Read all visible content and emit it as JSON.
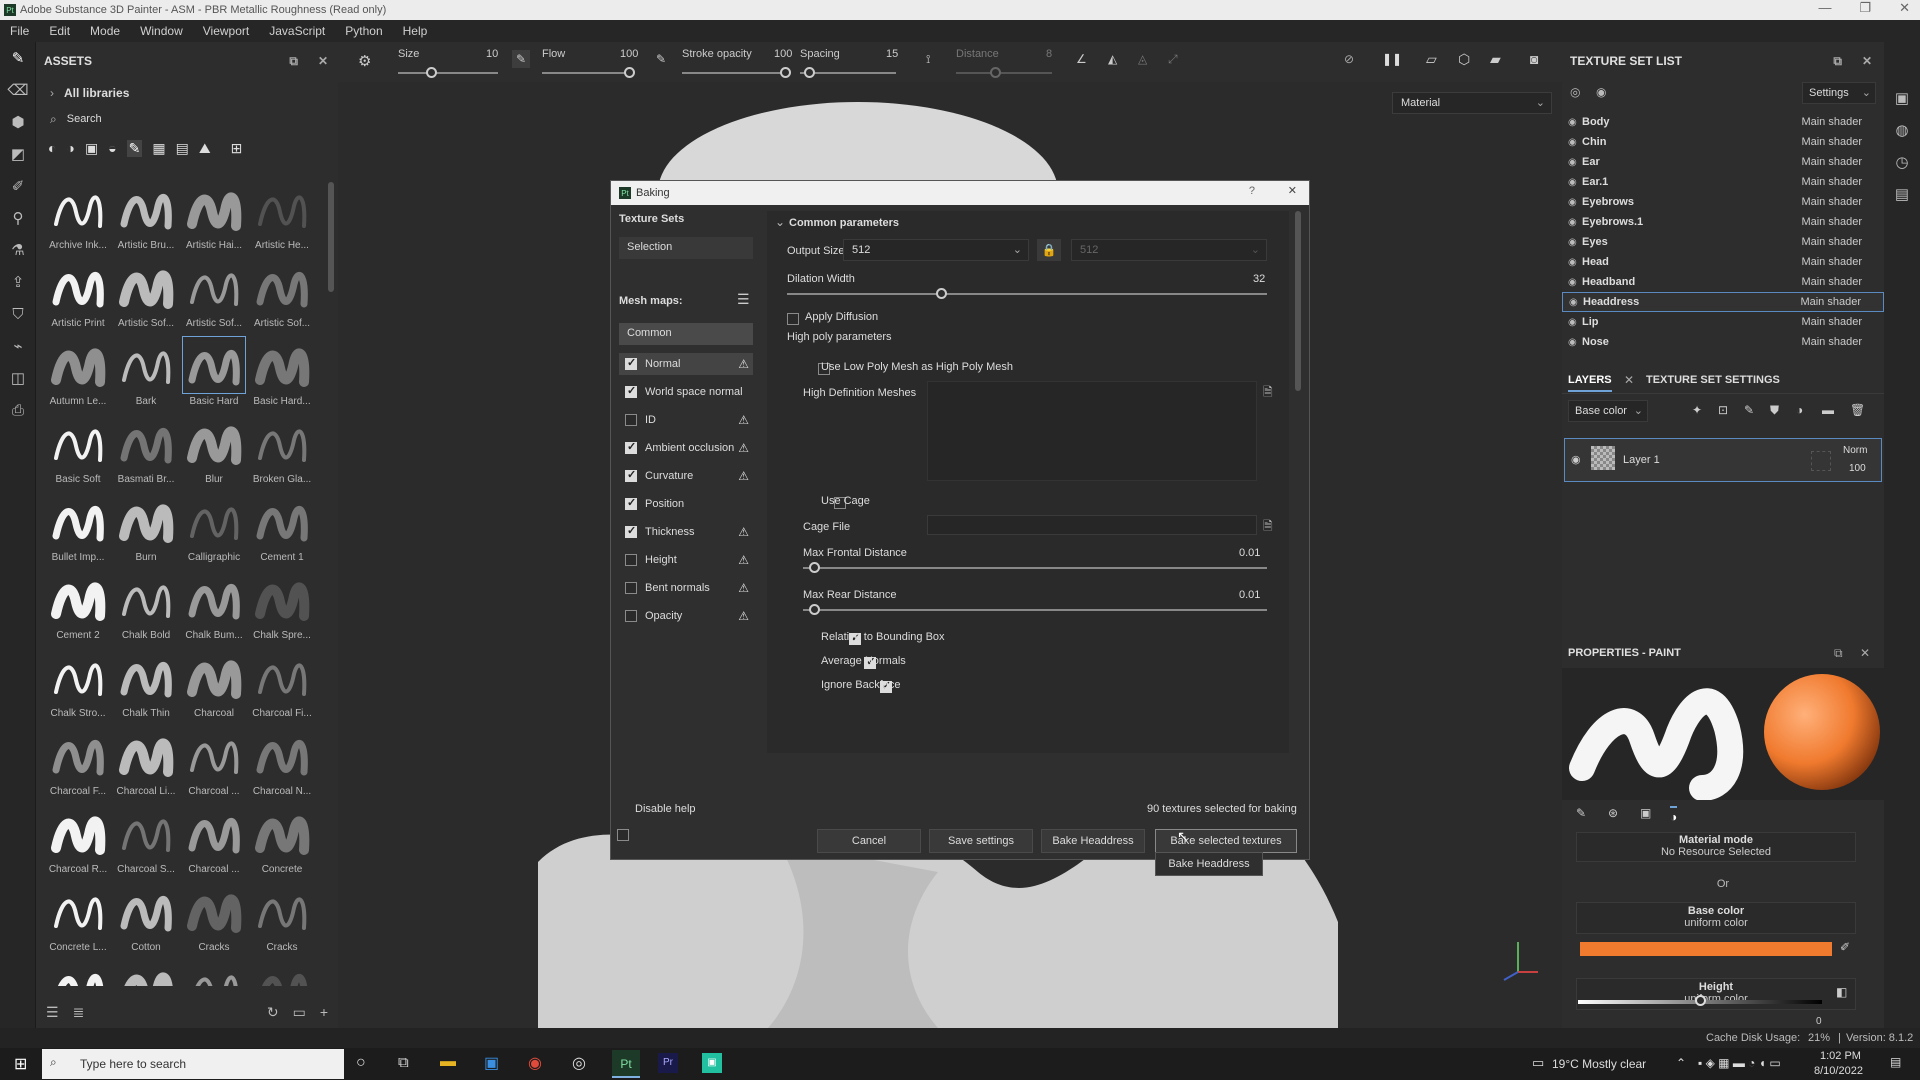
{
  "window": {
    "title": "Adobe Substance 3D Painter - ASM - PBR Metallic Roughness (Read only)",
    "logo": "Pt"
  },
  "menu": [
    "File",
    "Edit",
    "Mode",
    "Window",
    "Viewport",
    "JavaScript",
    "Python",
    "Help"
  ],
  "assets": {
    "title": "ASSETS",
    "libraries": "All libraries",
    "search_placeholder": "Search",
    "brushes": [
      "Archive Ink...",
      "Artistic Bru...",
      "Artistic Hai...",
      "Artistic He...",
      "Artistic Print",
      "Artistic Sof...",
      "Artistic Sof...",
      "Artistic Sof...",
      "Autumn Le...",
      "Bark",
      "Basic Hard",
      "Basic Hard...",
      "Basic Soft",
      "Basmati Br...",
      "Blur",
      "Broken Gla...",
      "Bullet Imp...",
      "Burn",
      "Calligraphic",
      "Cement 1",
      "Cement 2",
      "Chalk Bold",
      "Chalk Bum...",
      "Chalk Spre...",
      "Chalk Stro...",
      "Chalk Thin",
      "Charcoal",
      "Charcoal Fi...",
      "Charcoal F...",
      "Charcoal Li...",
      "Charcoal ...",
      "Charcoal N...",
      "Charcoal R...",
      "Charcoal S...",
      "Charcoal ...",
      "Concrete",
      "Concrete L...",
      "Cotton",
      "Cracks",
      "Cracks",
      "",
      "",
      "",
      ""
    ],
    "selected_index": 10
  },
  "toolbar": {
    "size_label": "Size",
    "size_value": "10",
    "flow_label": "Flow",
    "flow_value": "100",
    "stroke_label": "Stroke opacity",
    "stroke_value": "100",
    "spacing_label": "Spacing",
    "spacing_value": "15",
    "distance_label": "Distance",
    "distance_value": "8"
  },
  "viewport": {
    "material_select": "Material"
  },
  "texture_set_list": {
    "title": "TEXTURE SET LIST",
    "settings_label": "Settings",
    "rows": [
      {
        "name": "Body",
        "shader": "Main shader"
      },
      {
        "name": "Chin",
        "shader": "Main shader"
      },
      {
        "name": "Ear",
        "shader": "Main shader"
      },
      {
        "name": "Ear.1",
        "shader": "Main shader"
      },
      {
        "name": "Eyebrows",
        "shader": "Main shader"
      },
      {
        "name": "Eyebrows.1",
        "shader": "Main shader"
      },
      {
        "name": "Eyes",
        "shader": "Main shader"
      },
      {
        "name": "Head",
        "shader": "Main shader"
      },
      {
        "name": "Headband",
        "shader": "Main shader"
      },
      {
        "name": "Headdress",
        "shader": "Main shader"
      },
      {
        "name": "Lip",
        "shader": "Main shader"
      },
      {
        "name": "Nose",
        "shader": "Main shader"
      }
    ],
    "selected": 9
  },
  "layers": {
    "tab_layers": "LAYERS",
    "tab_settings": "TEXTURE SET SETTINGS",
    "channel": "Base color",
    "layer_name": "Layer 1",
    "blend": "Norm",
    "opacity": "100"
  },
  "properties": {
    "title": "PROPERTIES - PAINT",
    "material_mode": "Material mode",
    "no_resource": "No Resource Selected",
    "or": "Or",
    "base_color": "Base color",
    "base_color_sub": "uniform color",
    "base_color_hex": "#f07a2e",
    "height": "Height",
    "height_sub": "uniform color",
    "height_value": "0",
    "height_level": 0.5
  },
  "baking": {
    "title": "Baking",
    "texture_sets": "Texture Sets",
    "selection": "Selection",
    "mesh_maps": "Mesh maps:",
    "common": "Common",
    "maps": [
      {
        "name": "Normal",
        "on": true,
        "warn": true,
        "sel": true
      },
      {
        "name": "World space normal",
        "on": true,
        "warn": false
      },
      {
        "name": "ID",
        "on": false,
        "warn": true
      },
      {
        "name": "Ambient occlusion",
        "on": true,
        "warn": true
      },
      {
        "name": "Curvature",
        "on": true,
        "warn": true
      },
      {
        "name": "Position",
        "on": true,
        "warn": false
      },
      {
        "name": "Thickness",
        "on": true,
        "warn": true
      },
      {
        "name": "Height",
        "on": false,
        "warn": true
      },
      {
        "name": "Bent normals",
        "on": false,
        "warn": true
      },
      {
        "name": "Opacity",
        "on": false,
        "warn": true
      }
    ],
    "common_params": "Common parameters",
    "output_size_label": "Output Size",
    "output_size": "512",
    "output_size_locked": "512",
    "dilation_label": "Dilation Width",
    "dilation_value": "32",
    "dilation_fraction": 0.32,
    "apply_diffusion": "Apply Diffusion",
    "high_poly": "High poly parameters",
    "use_low_poly": "Use Low Poly Mesh as High Poly Mesh",
    "hd_meshes": "High Definition Meshes",
    "use_cage": "Use Cage",
    "cage_file": "Cage File",
    "max_frontal": "Max Frontal Distance",
    "max_frontal_value": "0.01",
    "max_rear": "Max Rear Distance",
    "max_rear_value": "0.01",
    "relative_bb": "Relative to Bounding Box",
    "average_normals": "Average Normals",
    "ignore_backface": "Ignore Backface",
    "disable_help": "Disable help",
    "count": "90 textures selected for baking",
    "cancel": "Cancel",
    "save_settings": "Save settings",
    "bake_headdress": "Bake Headdress",
    "bake_selected": "Bake selected textures",
    "tooltip": "Bake Headdress"
  },
  "statusbar": {
    "cache": "Cache Disk Usage:",
    "cache_value": "21%",
    "version": "Version: 8.1.2"
  },
  "taskbar": {
    "search_placeholder": "Type here to search",
    "weather": "19°C  Mostly clear",
    "time": "1:02 PM",
    "date": "8/10/2022"
  }
}
